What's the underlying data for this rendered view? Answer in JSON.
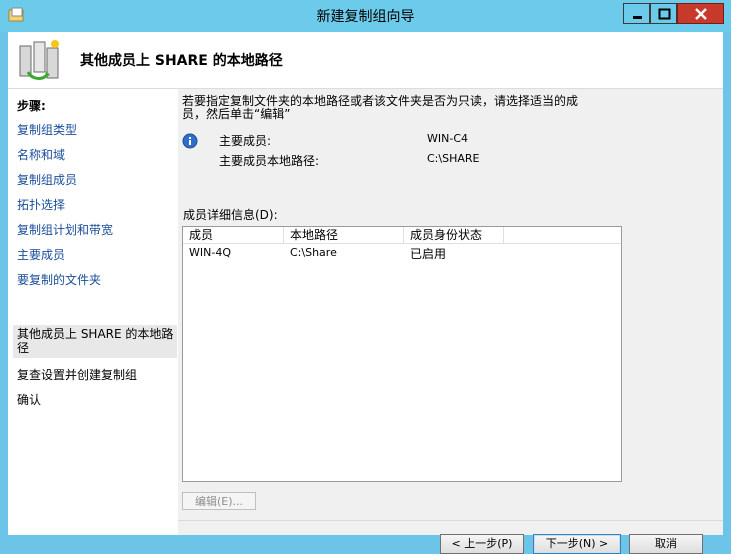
{
  "window": {
    "title": "新建复制组向导",
    "minimize_icon": "minimize-icon",
    "maximize_icon": "maximize-icon",
    "close_icon": "close-icon"
  },
  "header": {
    "title": "其他成员上 SHARE 的本地路径",
    "icon": "replication-group-icon"
  },
  "sidebar": {
    "heading": "步骤:",
    "steps": [
      {
        "label": "复制组类型"
      },
      {
        "label": "名称和域"
      },
      {
        "label": "复制组成员"
      },
      {
        "label": "拓扑选择"
      },
      {
        "label": "复制组计划和带宽"
      },
      {
        "label": "主要成员"
      },
      {
        "label": "要复制的文件夹"
      },
      {
        "label": "其他成员上 SHARE 的本地路径",
        "current": true
      },
      {
        "label": "复查设置并创建复制组"
      },
      {
        "label": "确认"
      }
    ]
  },
  "content": {
    "instruction": "若要指定复制文件夹的本地路径或者该文件夹是否为只读，请选择适当的成员，然后单击“编辑”",
    "primary_member_label": "主要成员:",
    "primary_member_value": "WIN-C4",
    "primary_path_label": "主要成员本地路径:",
    "primary_path_value": "C:\\SHARE",
    "list_label": "成员详细信息(D):",
    "columns": [
      "成员",
      "本地路径",
      "成员身份状态"
    ],
    "rows": [
      {
        "member": "WIN-4Q",
        "path": "C:\\Share",
        "status": "已启用"
      }
    ],
    "edit_button": "编辑(E)..."
  },
  "footer": {
    "back_button": "< 上一步(P)",
    "next_button": "下一步(N) >",
    "cancel_button": "取消"
  }
}
